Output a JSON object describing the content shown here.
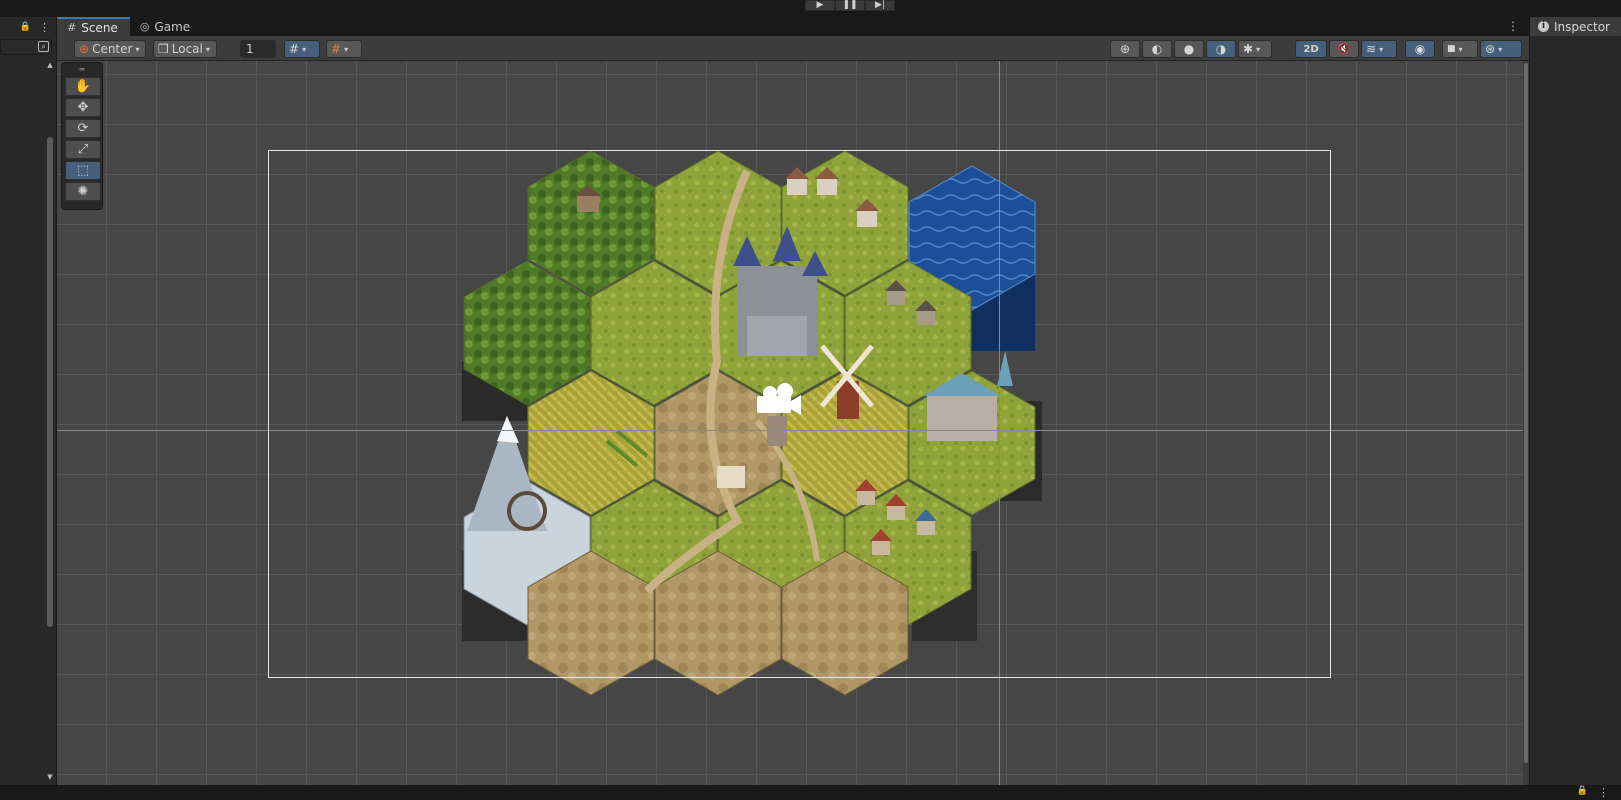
{
  "playbar": {
    "play_icon": "▶",
    "pause_icon": "❚❚",
    "step_icon": "▶|"
  },
  "hierarchy": {
    "lock_icon": "🔒",
    "menu_icon": "⋮",
    "search_icon": "⌕",
    "scroll_up": "▲",
    "scroll_down": "▼"
  },
  "tabs": [
    {
      "label": "Scene",
      "icon": "#",
      "active": true
    },
    {
      "label": "Game",
      "icon": "◎",
      "active": false
    }
  ],
  "tabs_menu_icon": "⋮",
  "toolbar": {
    "pivot_label": "Center",
    "pivot_icon": "⊕",
    "space_label": "Local",
    "space_icon": "❒",
    "snap_value": "1",
    "grid_icon": "#",
    "snap_icon": "#",
    "caret": "▾",
    "draw_mode_icons": [
      "⊕",
      "◐",
      "●",
      "◑"
    ],
    "debug_icon": "✱",
    "mode_2d_label": "2D",
    "audio_icon": "🔇",
    "effects_icon": "≋",
    "visibility_icon": "◉",
    "camera_icon": "■",
    "gizmos_icon": "⊛"
  },
  "tools": {
    "grip": "═",
    "items": [
      {
        "name": "hand-tool",
        "icon": "✋",
        "active": false
      },
      {
        "name": "move-tool",
        "icon": "✥",
        "active": false
      },
      {
        "name": "rotate-tool",
        "icon": "⟳",
        "active": false
      },
      {
        "name": "scale-tool",
        "icon": "⤢",
        "active": false
      },
      {
        "name": "rect-tool",
        "icon": "⬚",
        "active": true
      },
      {
        "name": "transform-tool",
        "icon": "✺",
        "active": false
      }
    ]
  },
  "inspector": {
    "label": "Inspector",
    "icon": "i"
  },
  "bottom": {
    "lock_icon": "🔒",
    "menu_icon": "⋮"
  },
  "colors": {
    "grass": "#8fa33a",
    "forest": "#4f7a28",
    "dirt": "#b09765",
    "water": "#1d4f98",
    "mountain": "#c9d4dc",
    "accent_blue": "#46607c",
    "viewport_bg": "#464646"
  }
}
